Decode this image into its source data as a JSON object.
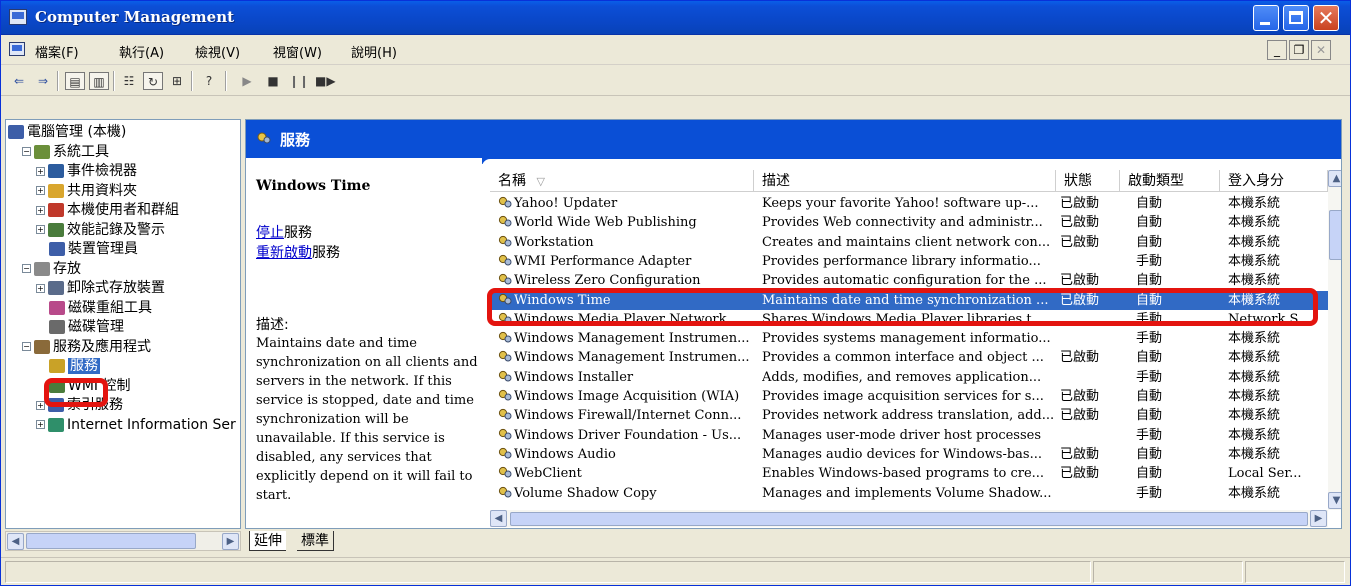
{
  "window": {
    "title": "Computer Management"
  },
  "menu": [
    "檔案(F)",
    "執行(A)",
    "檢視(V)",
    "視窗(W)",
    "說明(H)"
  ],
  "tree": {
    "items": [
      {
        "label": "電腦管理 (本機)",
        "level": 0,
        "expander": "",
        "icon": "computer-mgmt-icon",
        "color": "#3d5ea8"
      },
      {
        "label": "系統工具",
        "level": 1,
        "expander": "−",
        "icon": "system-tools-icon",
        "color": "#6b8f3a"
      },
      {
        "label": "事件檢視器",
        "level": 2,
        "expander": "+",
        "icon": "event-viewer-icon",
        "color": "#2c5c9e"
      },
      {
        "label": "共用資料夾",
        "level": 2,
        "expander": "+",
        "icon": "shared-folders-icon",
        "color": "#d9a62e"
      },
      {
        "label": "本機使用者和群組",
        "level": 2,
        "expander": "+",
        "icon": "users-groups-icon",
        "color": "#c0392b"
      },
      {
        "label": "效能記錄及警示",
        "level": 2,
        "expander": "+",
        "icon": "performance-icon",
        "color": "#4a7c3c"
      },
      {
        "label": "裝置管理員",
        "level": 2,
        "expander": "",
        "icon": "device-manager-icon",
        "color": "#3d5ea8"
      },
      {
        "label": "存放",
        "level": 1,
        "expander": "−",
        "icon": "storage-icon",
        "color": "#8a8a8a"
      },
      {
        "label": "卸除式存放裝置",
        "level": 2,
        "expander": "+",
        "icon": "removable-storage-icon",
        "color": "#5a6b8a"
      },
      {
        "label": "磁碟重組工具",
        "level": 2,
        "expander": "",
        "icon": "defrag-icon",
        "color": "#b84a8a"
      },
      {
        "label": "磁碟管理",
        "level": 2,
        "expander": "",
        "icon": "disk-management-icon",
        "color": "#6a6a6a"
      },
      {
        "label": "服務及應用程式",
        "level": 1,
        "expander": "−",
        "icon": "services-apps-icon",
        "color": "#8a6a3a"
      },
      {
        "label": "服務",
        "level": 2,
        "expander": "",
        "icon": "services-icon",
        "color": "#c9a227",
        "selected": true
      },
      {
        "label": "WMI 控制",
        "level": 2,
        "expander": "",
        "icon": "wmi-control-icon",
        "color": "#4a7c3c"
      },
      {
        "label": "索引服務",
        "level": 2,
        "expander": "+",
        "icon": "indexing-service-icon",
        "color": "#3d5ea8"
      },
      {
        "label": "Internet Information Ser",
        "level": 2,
        "expander": "+",
        "icon": "iis-icon",
        "color": "#2f8f6a"
      }
    ]
  },
  "right_header": {
    "title": "服務"
  },
  "service_detail": {
    "name": "Windows Time",
    "stop_link": "停止",
    "stop_suffix": "服務",
    "restart_link": "重新啟動",
    "restart_suffix": "服務",
    "description_label": "描述:",
    "description": "Maintains date and time synchronization on all clients and servers in the network. If this service is stopped, date and time synchronization will be unavailable. If this service is disabled, any services that explicitly depend on it will fail to start."
  },
  "columns": [
    "名稱",
    "描述",
    "狀態",
    "啟動類型",
    "登入身分"
  ],
  "sort_indicator": "▽",
  "rows": [
    {
      "name": "Yahoo! Updater",
      "description": "Keeps your favorite Yahoo! software up-...",
      "status": "已啟動",
      "startup": "自動",
      "logon": "本機系統"
    },
    {
      "name": "World Wide Web Publishing",
      "description": "Provides Web connectivity and administr...",
      "status": "已啟動",
      "startup": "自動",
      "logon": "本機系統"
    },
    {
      "name": "Workstation",
      "description": "Creates and maintains client network con...",
      "status": "已啟動",
      "startup": "自動",
      "logon": "本機系統"
    },
    {
      "name": "WMI Performance Adapter",
      "description": "Provides performance library informatio...",
      "status": "",
      "startup": "手動",
      "logon": "本機系統"
    },
    {
      "name": "Wireless Zero Configuration",
      "description": "Provides automatic configuration for the ...",
      "status": "已啟動",
      "startup": "自動",
      "logon": "本機系統"
    },
    {
      "name": "Windows Time",
      "description": "Maintains date and time synchronization ...",
      "status": "已啟動",
      "startup": "自動",
      "logon": "本機系統",
      "selected": true
    },
    {
      "name": "Windows Media Player Network ...",
      "description": "Shares Windows Media Player libraries t...",
      "status": "",
      "startup": "手動",
      "logon": "Network S..."
    },
    {
      "name": "Windows Management Instrumen...",
      "description": "Provides systems management informatio...",
      "status": "",
      "startup": "手動",
      "logon": "本機系統"
    },
    {
      "name": "Windows Management Instrumen...",
      "description": "Provides a common interface and object ...",
      "status": "已啟動",
      "startup": "自動",
      "logon": "本機系統"
    },
    {
      "name": "Windows Installer",
      "description": "Adds, modifies, and removes application...",
      "status": "",
      "startup": "手動",
      "logon": "本機系統"
    },
    {
      "name": "Windows Image Acquisition (WIA)",
      "description": "Provides image acquisition services for s...",
      "status": "已啟動",
      "startup": "自動",
      "logon": "本機系統"
    },
    {
      "name": "Windows Firewall/Internet Conn...",
      "description": "Provides network address translation, add...",
      "status": "已啟動",
      "startup": "自動",
      "logon": "本機系統"
    },
    {
      "name": "Windows Driver Foundation - Us...",
      "description": "Manages user-mode driver host processes",
      "status": "",
      "startup": "手動",
      "logon": "本機系統"
    },
    {
      "name": "Windows Audio",
      "description": "Manages audio devices for Windows-bas...",
      "status": "已啟動",
      "startup": "自動",
      "logon": "本機系統"
    },
    {
      "name": "WebClient",
      "description": "Enables Windows-based programs to cre...",
      "status": "已啟動",
      "startup": "自動",
      "logon": "Local Ser..."
    },
    {
      "name": "Volume Shadow Copy",
      "description": "Manages and implements Volume Shadow...",
      "status": "",
      "startup": "手動",
      "logon": "本機系統"
    }
  ],
  "tabs": [
    "延伸",
    "標準"
  ],
  "colors": {
    "titlebar": "#0a4fd6",
    "selection": "#316ac5",
    "highlight_box": "#e3140f",
    "link": "#0000cc"
  }
}
